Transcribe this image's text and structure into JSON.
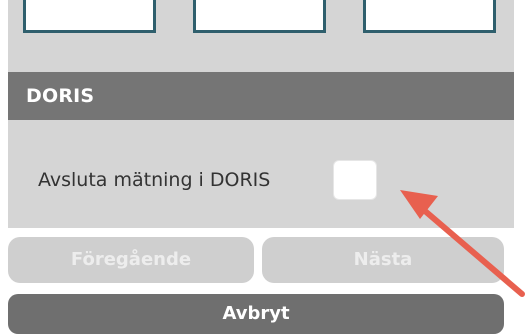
{
  "section": {
    "title": "DORIS",
    "row_label": "Avsluta mätning i DORIS",
    "checkbox_checked": false
  },
  "buttons": {
    "previous_label": "Föregående",
    "next_label": "Nästa",
    "cancel_label": "Avbryt"
  },
  "colors": {
    "panel_background": "#d5d5d5",
    "header_background": "#757575",
    "option_border": "#2f5f6d",
    "disabled_button": "#cfcfcf",
    "cancel_button": "#6f6f6f",
    "annotation_arrow": "#e8604f"
  }
}
